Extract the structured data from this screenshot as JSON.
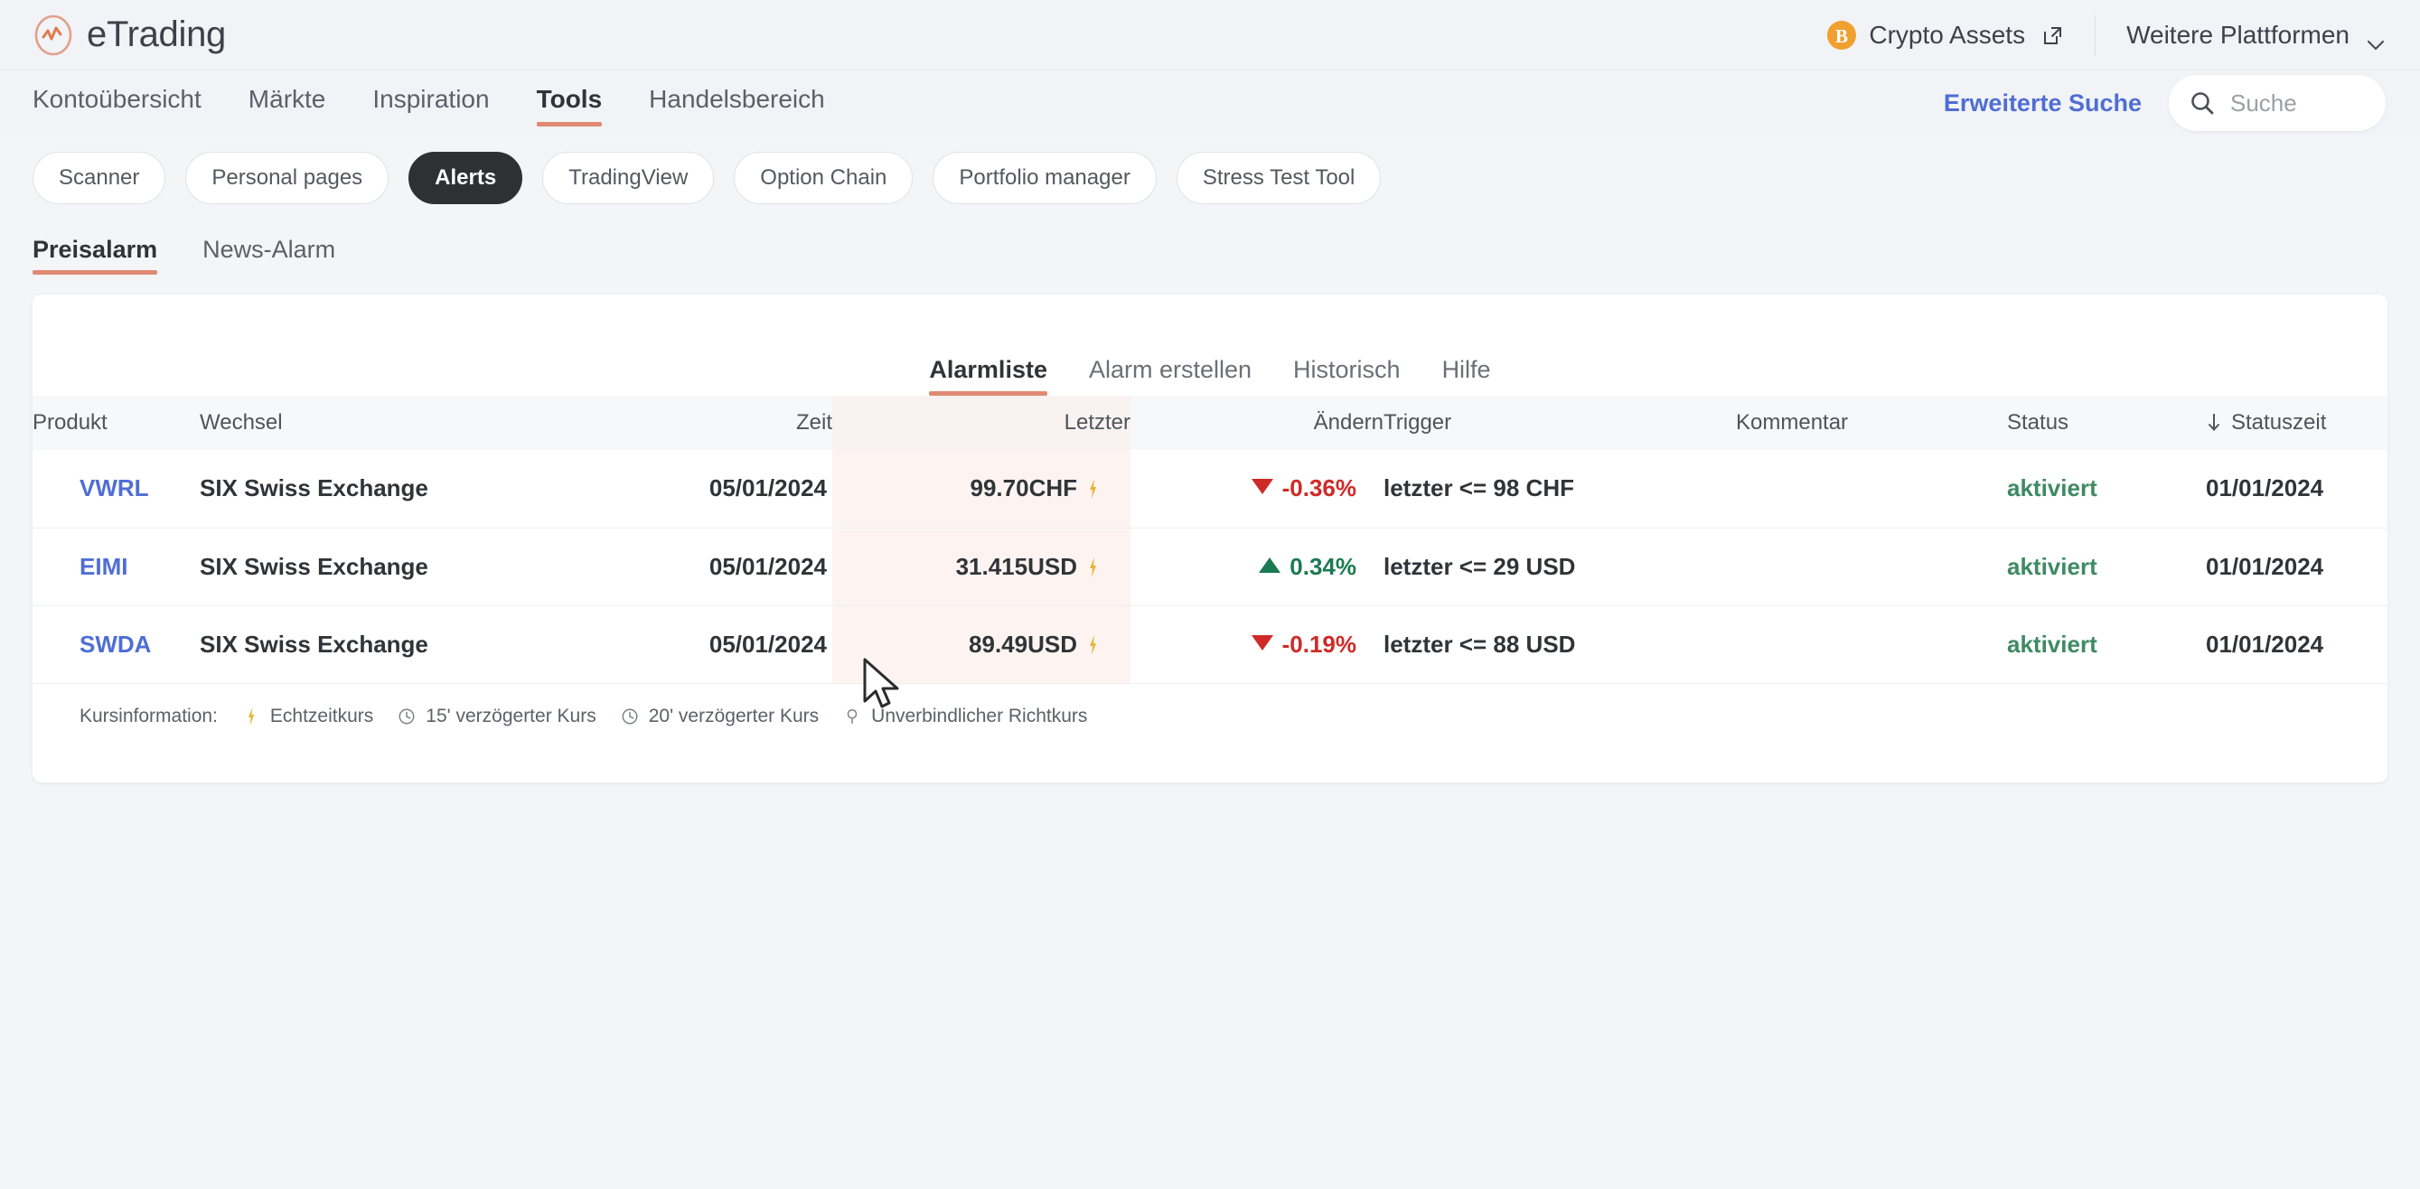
{
  "brand": {
    "name": "eTrading",
    "logo_icon": "wave-circle-icon"
  },
  "topbar": {
    "crypto_label": "Crypto Assets",
    "crypto_icon": "bitcoin-icon",
    "external_link_icon": "external-link-icon",
    "platforms_label": "Weitere Plattformen",
    "chevron_icon": "chevron-down-icon"
  },
  "nav": {
    "items": [
      {
        "label": "Kontoübersicht",
        "active": false
      },
      {
        "label": "Märkte",
        "active": false
      },
      {
        "label": "Inspiration",
        "active": false
      },
      {
        "label": "Tools",
        "active": true
      },
      {
        "label": "Handelsbereich",
        "active": false
      }
    ],
    "advanced_search_label": "Erweiterte Suche",
    "search_placeholder": "Suche",
    "search_value": "",
    "search_icon": "search-icon"
  },
  "tools_pills": [
    {
      "label": "Scanner",
      "active": false
    },
    {
      "label": "Personal pages",
      "active": false
    },
    {
      "label": "Alerts",
      "active": true
    },
    {
      "label": "TradingView",
      "active": false
    },
    {
      "label": "Option Chain",
      "active": false
    },
    {
      "label": "Portfolio manager",
      "active": false
    },
    {
      "label": "Stress Test Tool",
      "active": false
    }
  ],
  "alarm_tabs": [
    {
      "label": "Preisalarm",
      "active": true
    },
    {
      "label": "News-Alarm",
      "active": false
    }
  ],
  "card_tabs": [
    {
      "label": "Alarmliste",
      "active": true
    },
    {
      "label": "Alarm erstellen",
      "active": false
    },
    {
      "label": "Historisch",
      "active": false
    },
    {
      "label": "Hilfe",
      "active": false
    }
  ],
  "table": {
    "sort_icon": "sort-descending-arrow-icon",
    "headers": {
      "produkt": "Produkt",
      "wechsel": "Wechsel",
      "zeit": "Zeit",
      "letzter": "Letzter",
      "aendern": "Ändern",
      "trigger": "Trigger",
      "kommentar": "Kommentar",
      "status": "Status",
      "statuszeit": "Statuszeit"
    },
    "rows": [
      {
        "produkt": "VWRL",
        "wechsel": "SIX Swiss Exchange",
        "zeit": "05/01/2024",
        "letzter": "99.70CHF",
        "quote_icon": "realtime-bolt-icon",
        "aendern": "-0.36%",
        "direction": "down",
        "trigger": "letzter <= 98 CHF",
        "kommentar": "",
        "status": "aktiviert",
        "statuszeit": "01/01/2024"
      },
      {
        "produkt": "EIMI",
        "wechsel": "SIX Swiss Exchange",
        "zeit": "05/01/2024",
        "letzter": "31.415USD",
        "quote_icon": "realtime-bolt-icon",
        "aendern": "0.34%",
        "direction": "up",
        "trigger": "letzter <= 29 USD",
        "kommentar": "",
        "status": "aktiviert",
        "statuszeit": "01/01/2024"
      },
      {
        "produkt": "SWDA",
        "wechsel": "SIX Swiss Exchange",
        "zeit": "05/01/2024",
        "letzter": "89.49USD",
        "quote_icon": "realtime-bolt-icon",
        "aendern": "-0.19%",
        "direction": "down",
        "trigger": "letzter <= 88 USD",
        "kommentar": "",
        "status": "aktiviert",
        "statuszeit": "01/01/2024"
      }
    ]
  },
  "legend": {
    "label": "Kursinformation:",
    "items": [
      {
        "icon": "realtime-bolt-icon",
        "label": "Echtzeitkurs"
      },
      {
        "icon": "clock-icon",
        "label": "15' verzögerter Kurs"
      },
      {
        "icon": "clock-icon",
        "label": "20' verzögerter Kurs"
      },
      {
        "icon": "pin-icon",
        "label": "Unverbindlicher Richtkurs"
      }
    ]
  },
  "colors": {
    "accent": "#e08a73",
    "link": "#4f6ed4",
    "up": "#1b7a53",
    "down": "#cf2a27",
    "status_ok": "#3f8a63",
    "bitcoin": "#f0a02e",
    "page_bg": "#f4f5f7"
  }
}
